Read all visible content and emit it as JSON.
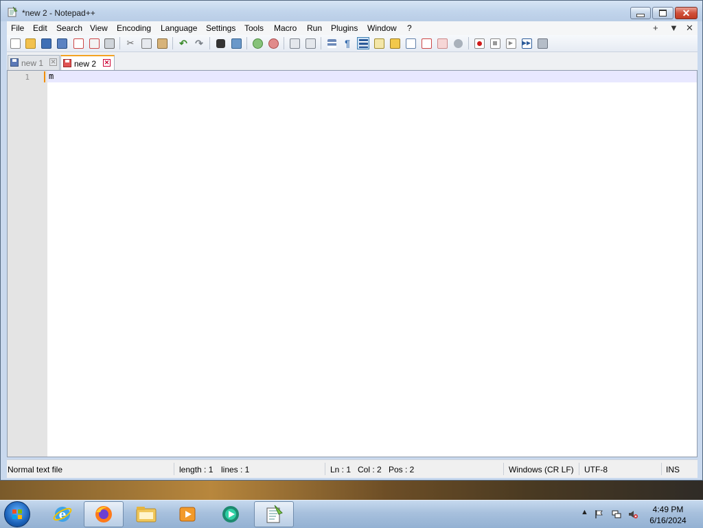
{
  "window": {
    "title": "*new 2 - Notepad++",
    "accent_orange": "#f4a321",
    "close_color": "#c23b22"
  },
  "menu": {
    "items": [
      "File",
      "Edit",
      "Search",
      "View",
      "Encoding",
      "Language",
      "Settings",
      "Tools",
      "Macro",
      "Run",
      "Plugins",
      "Window",
      "?"
    ],
    "right": [
      "+",
      "▼",
      "✕"
    ]
  },
  "toolbar": {
    "icons": [
      "new-file-icon",
      "open-file-icon",
      "save-icon",
      "save-all-icon",
      "close-icon",
      "close-all-icon",
      "print-icon",
      "cut-icon",
      "copy-icon",
      "paste-icon",
      "undo-icon",
      "redo-icon",
      "find-icon",
      "replace-icon",
      "zoom-in-icon",
      "zoom-out-icon",
      "sync-vertical-icon",
      "sync-horizontal-icon",
      "word-wrap-icon",
      "show-all-chars-icon",
      "indent-guide-icon",
      "user-lang-icon",
      "doc-map-icon",
      "function-list-icon",
      "folder-workspace-icon",
      "monitoring-icon",
      "record-macro-icon",
      "stop-macro-icon",
      "play-macro-icon",
      "run-macro-multiple-icon",
      "save-macro-icon"
    ]
  },
  "tabs": [
    {
      "label": "new 1",
      "active": false
    },
    {
      "label": "new 2",
      "active": true
    }
  ],
  "editor": {
    "line_numbers": [
      "1"
    ],
    "content": "m"
  },
  "statusbar": {
    "file_type": "Normal text file",
    "length": "length : 1",
    "lines": "lines : 1",
    "ln": "Ln : 1",
    "col": "Col : 2",
    "pos": "Pos : 2",
    "eol": "Windows (CR LF)",
    "encoding": "UTF-8",
    "mode": "INS"
  },
  "taskbar": {
    "apps": [
      "internet-explorer-icon",
      "firefox-icon",
      "file-explorer-icon",
      "media-player-icon",
      "media-center-icon",
      "notepad-plus-plus-icon"
    ],
    "clock_time": "4:49 PM",
    "clock_date": "6/16/2024"
  }
}
